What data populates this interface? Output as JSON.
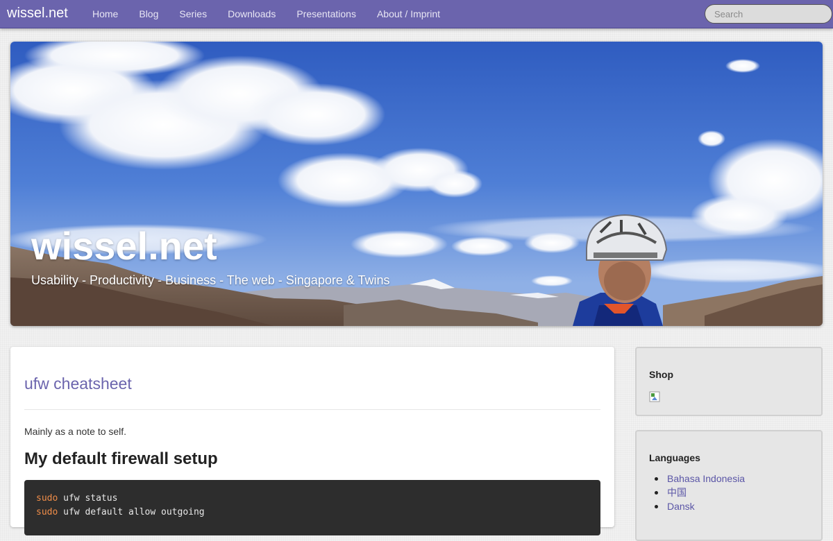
{
  "nav": {
    "brand": "wissel.net",
    "links": [
      "Home",
      "Blog",
      "Series",
      "Downloads",
      "Presentations",
      "About / Imprint"
    ],
    "search_placeholder": "Search"
  },
  "hero": {
    "title": "wissel.net",
    "tagline": "Usability - Productivity - Business - The web - Singapore & Twins"
  },
  "post": {
    "title": "ufw cheatsheet",
    "intro": "Mainly as a note to self.",
    "section_heading": "My default firewall setup",
    "code_lines": [
      {
        "kw": "sudo",
        "rest": " ufw status"
      },
      {
        "kw": "sudo",
        "rest": " ufw default allow outgoing"
      }
    ]
  },
  "sidebar": {
    "shop_heading": "Shop",
    "languages_heading": "Languages",
    "languages": [
      "Bahasa Indonesia",
      "中国",
      "Dansk"
    ]
  },
  "colors": {
    "navbar": "#6b64ad",
    "link": "#6b64ad",
    "code_bg": "#2d2d2d",
    "code_keyword": "#f08d49"
  }
}
